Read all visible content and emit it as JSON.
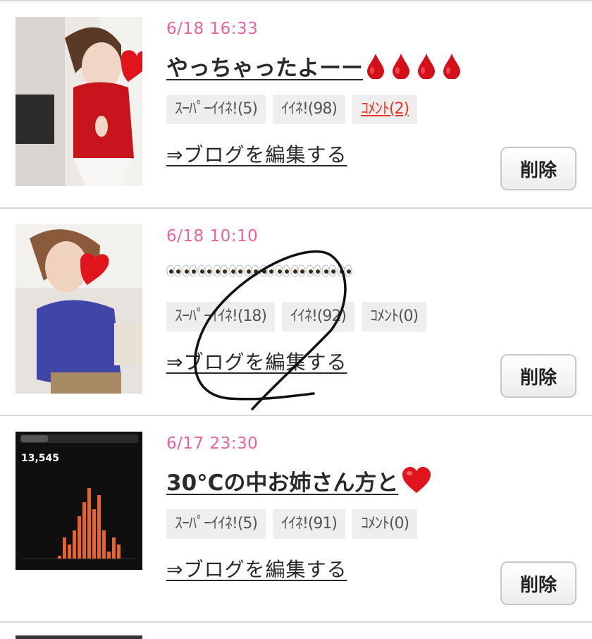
{
  "entries": [
    {
      "date": "6/18 16:33",
      "title": "やっちゃったよーー",
      "title_emoji": [
        "blood-drop-icon",
        "blood-drop-icon",
        "blood-drop-icon",
        "blood-drop-icon"
      ],
      "super_like": "ｽｰﾊﾟｰｲｲﾈ!(5)",
      "like": "ｲｲﾈ!(98)",
      "comment": "ｺﾒﾝﾄ(2)",
      "edit_label": "⇒ブログを編集する",
      "delete_label": "削除"
    },
    {
      "date": "6/18 10:10",
      "title": "",
      "title_emoji": [
        "eyes-icon",
        "eyes-icon",
        "eyes-icon",
        "eyes-icon",
        "eyes-icon",
        "eyes-icon",
        "eyes-icon",
        "eyes-icon",
        "eyes-icon",
        "eyes-icon",
        "eyes-icon",
        "eyes-icon"
      ],
      "super_like": "ｽｰﾊﾟｰｲｲﾈ!(18)",
      "like": "ｲｲﾈ!(92)",
      "comment": "ｺﾒﾝﾄ(0)",
      "edit_label": "⇒ブログを編集する",
      "delete_label": "削除"
    },
    {
      "date": "6/17 23:30",
      "title": "30°Cの中お姉さん方と",
      "title_emoji": [
        "heart-icon"
      ],
      "super_like": "ｽｰﾊﾟｰｲｲﾈ!(5)",
      "like": "ｲｲﾈ!(91)",
      "comment": "ｺﾒﾝﾄ(0)",
      "edit_label": "⇒ブログを編集する",
      "delete_label": "削除",
      "thumb_steps": "13,545"
    }
  ],
  "colors": {
    "date": "#e9649e",
    "comment_active": "#e8352b",
    "bar": "#e8632a"
  }
}
